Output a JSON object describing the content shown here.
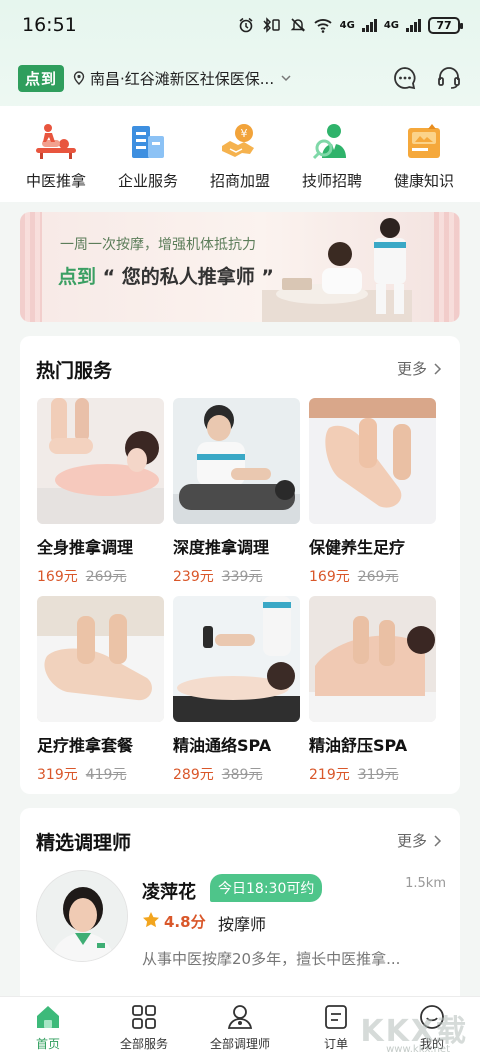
{
  "status_bar": {
    "time": "16:51",
    "battery": "77",
    "network_a": "4G",
    "network_b": "4G"
  },
  "header": {
    "brand": "点到",
    "location": "南昌·红谷滩新区社保医保..."
  },
  "categories": [
    {
      "label": "中医推拿",
      "icon": "massage-icon"
    },
    {
      "label": "企业服务",
      "icon": "building-icon"
    },
    {
      "label": "招商加盟",
      "icon": "handshake-icon"
    },
    {
      "label": "技师招聘",
      "icon": "recruit-icon"
    },
    {
      "label": "健康知识",
      "icon": "knowledge-icon"
    }
  ],
  "banner": {
    "subtitle": "一周一次按摩，增强机体抵抗力",
    "brand": "点到",
    "slogan": "“ 您的私人推拿师 ”"
  },
  "hot_services": {
    "title": "热门服务",
    "more": "更多",
    "items": [
      {
        "name": "全身推拿调理",
        "price": "169元",
        "old_price": "269元"
      },
      {
        "name": "深度推拿调理",
        "price": "239元",
        "old_price": "339元"
      },
      {
        "name": "保健养生足疗",
        "price": "169元",
        "old_price": "269元"
      },
      {
        "name": "足疗推拿套餐",
        "price": "319元",
        "old_price": "419元"
      },
      {
        "name": "精油通络SPA",
        "price": "289元",
        "old_price": "389元"
      },
      {
        "name": "精油舒压SPA",
        "price": "219元",
        "old_price": "319元"
      }
    ]
  },
  "therapists": {
    "title": "精选调理师",
    "more": "更多",
    "featured": {
      "name": "凌萍花",
      "availability": "今日18:30可约",
      "distance": "1.5km",
      "score": "4.8分",
      "role": "按摩师",
      "description": "从事中医按摩20多年，擅长中医推拿..."
    }
  },
  "tabbar": [
    {
      "label": "首页",
      "active": true
    },
    {
      "label": "全部服务",
      "active": false
    },
    {
      "label": "全部调理师",
      "active": false
    },
    {
      "label": "订单",
      "active": false
    },
    {
      "label": "我的",
      "active": false
    }
  ],
  "watermark": {
    "text": "KKX载",
    "url": "www.kkx.net"
  },
  "colors": {
    "brand_green": "#2f9e5d",
    "price_orange": "#d9572a",
    "badge_green": "#4ec58a"
  }
}
